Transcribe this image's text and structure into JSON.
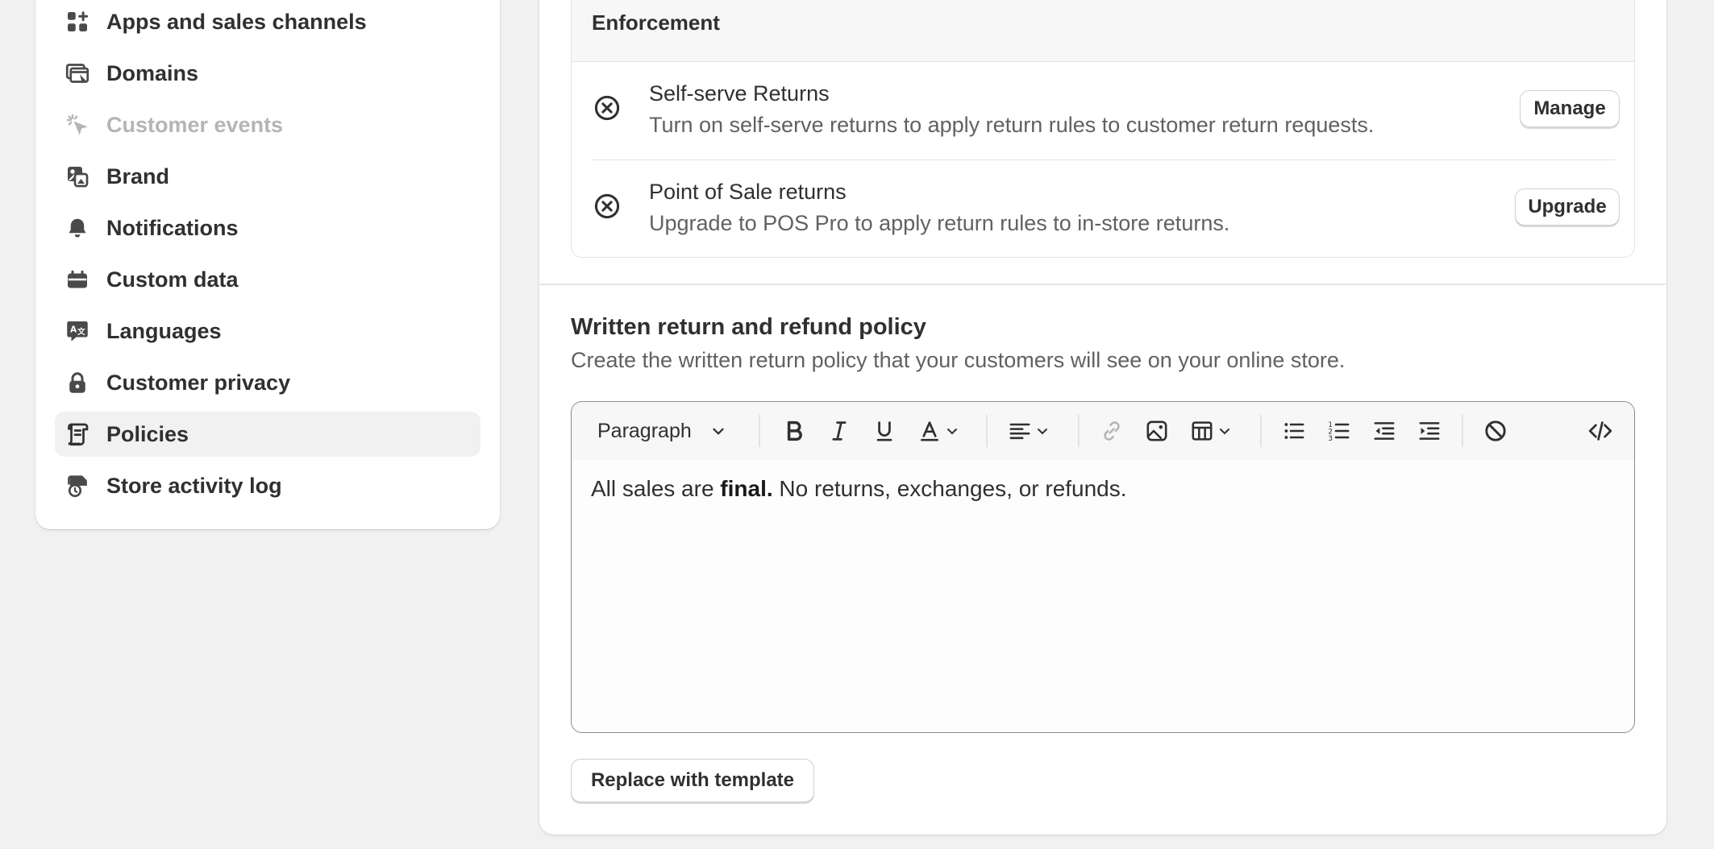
{
  "sidebar": {
    "items": [
      {
        "label": "Apps and sales channels",
        "icon": "apps-icon",
        "state": "normal"
      },
      {
        "label": "Domains",
        "icon": "domains-icon",
        "state": "normal"
      },
      {
        "label": "Customer events",
        "icon": "cursor-click-icon",
        "state": "disabled"
      },
      {
        "label": "Brand",
        "icon": "brand-icon",
        "state": "normal"
      },
      {
        "label": "Notifications",
        "icon": "bell-icon",
        "state": "normal"
      },
      {
        "label": "Custom data",
        "icon": "custom-data-icon",
        "state": "normal"
      },
      {
        "label": "Languages",
        "icon": "language-icon",
        "state": "normal"
      },
      {
        "label": "Customer privacy",
        "icon": "lock-icon",
        "state": "normal"
      },
      {
        "label": "Policies",
        "icon": "policies-icon",
        "state": "active"
      },
      {
        "label": "Store activity log",
        "icon": "activity-log-icon",
        "state": "normal"
      }
    ]
  },
  "enforcement": {
    "header": "Enforcement",
    "rows": [
      {
        "title": "Self-serve Returns",
        "description": "Turn on self-serve returns to apply return rules to customer return requests.",
        "button": "Manage",
        "icon": "circle-x-icon"
      },
      {
        "title": "Point of Sale returns",
        "description": "Upgrade to POS Pro to apply return rules to in-store returns.",
        "button": "Upgrade",
        "icon": "circle-x-icon"
      }
    ]
  },
  "policy": {
    "title": "Written return and refund policy",
    "description": "Create the written return policy that your customers will see on your online store.",
    "toolbar": {
      "block_format": "Paragraph",
      "tools": [
        "bold-icon",
        "italic-icon",
        "underline-icon",
        "text-color-icon",
        "align-icon",
        "link-icon",
        "image-icon",
        "table-icon",
        "bullet-list-icon",
        "numbered-list-icon",
        "outdent-icon",
        "indent-icon",
        "clear-format-icon",
        "code-icon"
      ]
    },
    "content": {
      "before": "All sales are ",
      "bold": "final.",
      "after": " No returns, exchanges, or refunds."
    },
    "replace_button": "Replace with template"
  },
  "colors": {
    "background": "#f1f1f1",
    "card": "#ffffff",
    "text": "#303030",
    "muted_text": "#616161",
    "disabled_text": "#b5b5b5",
    "border": "#e3e3e3"
  }
}
